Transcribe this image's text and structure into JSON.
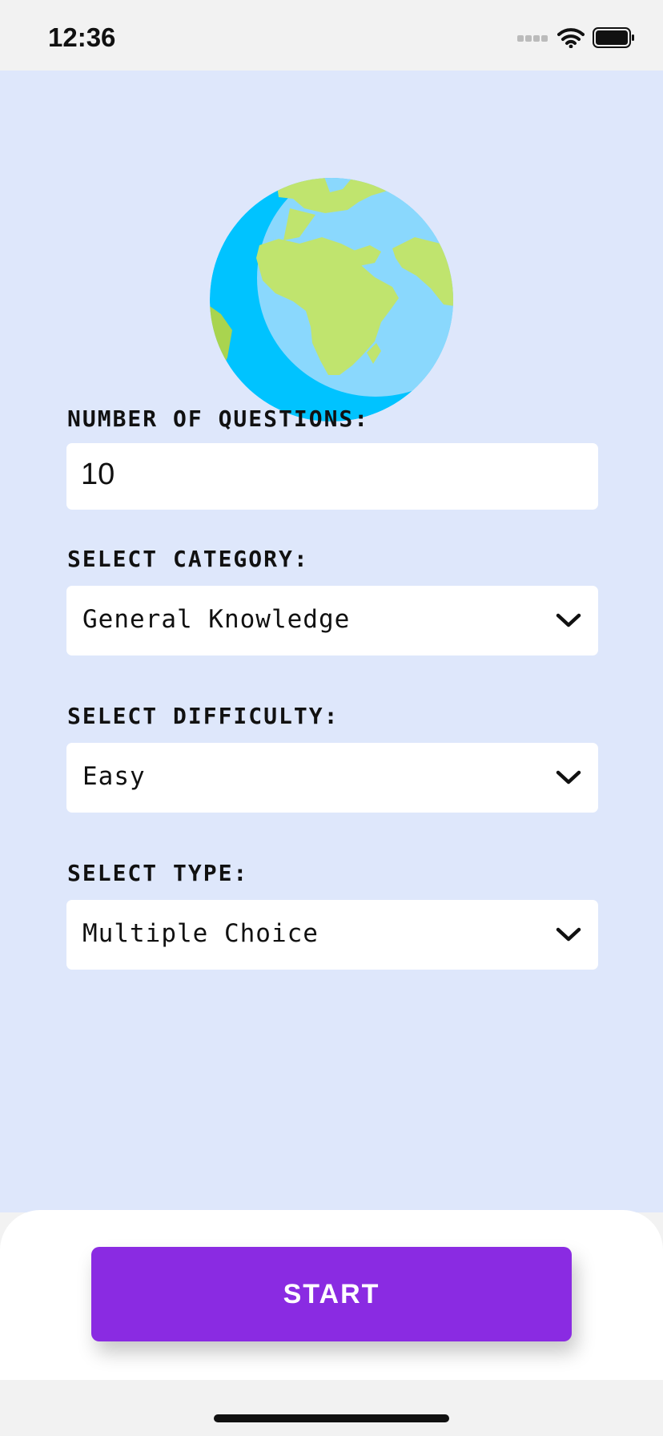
{
  "status_bar": {
    "time": "12:36",
    "icons": [
      "signal-dots-icon",
      "wifi-icon",
      "battery-icon"
    ]
  },
  "hero": {
    "icon": "globe-africa-icon"
  },
  "form": {
    "questions": {
      "label": "NUMBER OF QUESTIONS:",
      "value": "10"
    },
    "category": {
      "label": "SELECT CATEGORY:",
      "selected": "General Knowledge"
    },
    "difficulty": {
      "label": "SELECT DIFFICULTY:",
      "selected": "Easy"
    },
    "type": {
      "label": "SELECT TYPE:",
      "selected": "Multiple Choice"
    }
  },
  "actions": {
    "start_label": "START"
  },
  "colors": {
    "background": "#dee7fb",
    "accent": "#8a2be2",
    "field": "#ffffff"
  }
}
